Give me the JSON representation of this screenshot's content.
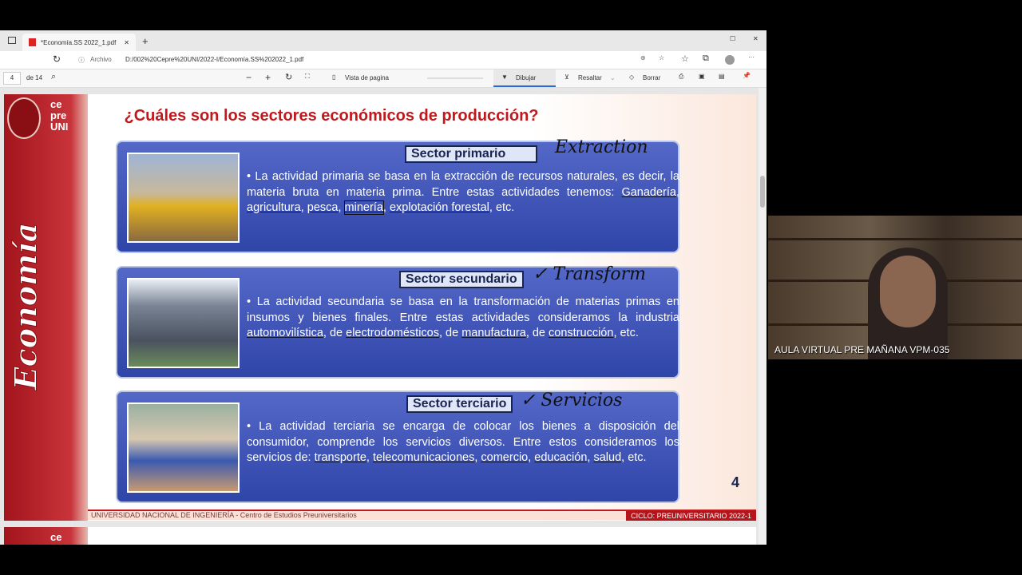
{
  "browser": {
    "tab_title": "*Economía.SS 2022_1.pdf",
    "address_prefix": "Archivo",
    "url": "D:/002%20Cepre%20UNI/2022-I/Economía.SS%202022_1.pdf"
  },
  "toolbar": {
    "page_current": "4",
    "page_total": "de 14",
    "page_view": "Vista de pagina",
    "draw": "Dibujar",
    "highlight": "Resaltar",
    "erase": "Borrar"
  },
  "slide": {
    "logo_text": "ce pre UNI",
    "side_title": "Economía",
    "title": "¿Cuáles son los sectores económicos de producción?",
    "sectors": [
      {
        "label": "Sector primario",
        "note": "Extraction",
        "text_before": "La actividad primaria se basa en la extracción de recursos naturales, es decir, la materia bruta en materia prima. Entre estas actividades tenemos: ",
        "items": [
          "Ganadería",
          "agricultura",
          "pesca",
          "minería",
          "explotación forestal"
        ],
        "text_after": ", etc."
      },
      {
        "label": "Sector secundario",
        "note": "✓ Transform",
        "text_before": "La actividad secundaria se basa en la transformación de materias primas en insumos y bienes finales. Entre estas actividades consideramos la industria ",
        "items": [
          "automovilística",
          "electrodomésticos",
          "manufactura",
          "construcción"
        ],
        "text_after": ", etc."
      },
      {
        "label": "Sector terciario",
        "note": "✓ Servicios",
        "text_before": "La actividad terciaria se encarga de colocar los bienes a disposición del consumidor, comprende los servicios diversos. Entre estos consideramos los servicios de: ",
        "items": [
          "transporte",
          "telecomunicaciones",
          "comercio",
          "educación",
          "salud"
        ],
        "text_after": ", etc."
      }
    ],
    "page_number": "4",
    "footer_left": "UNIVERSIDAD NACIONAL DE INGENIERÍA - Centro de Estudios Preuniversitarios",
    "footer_right": "CICLO: PREUNIVERSITARIO 2022-1"
  },
  "next_page": {
    "logo_text": "ce"
  },
  "webcam": {
    "label": "AULA VIRTUAL PRE MAÑANA VPM-035"
  }
}
